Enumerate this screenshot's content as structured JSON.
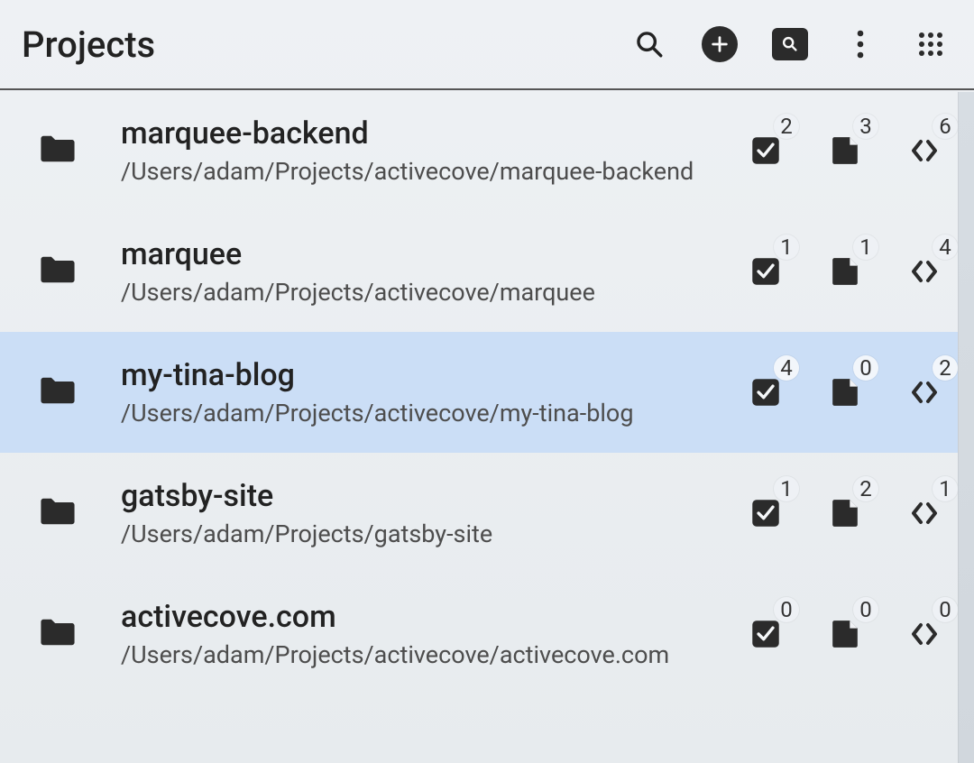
{
  "header": {
    "title": "Projects",
    "icons": {
      "search": "search-icon",
      "add": "add-icon",
      "findInProject": "find-in-project-icon",
      "more": "more-vert-icon",
      "apps": "apps-grid-icon"
    }
  },
  "projects": [
    {
      "name": "marquee-backend",
      "path": "/Users/adam/Projects/activecove/marquee-backend",
      "selected": false,
      "counts": {
        "todos": 2,
        "notes": 3,
        "snippets": 6
      }
    },
    {
      "name": "marquee",
      "path": "/Users/adam/Projects/activecove/marquee",
      "selected": false,
      "counts": {
        "todos": 1,
        "notes": 1,
        "snippets": 4
      }
    },
    {
      "name": "my-tina-blog",
      "path": "/Users/adam/Projects/activecove/my-tina-blog",
      "selected": true,
      "counts": {
        "todos": 4,
        "notes": 0,
        "snippets": 2
      }
    },
    {
      "name": "gatsby-site",
      "path": "/Users/adam/Projects/gatsby-site",
      "selected": false,
      "counts": {
        "todos": 1,
        "notes": 2,
        "snippets": 1
      }
    },
    {
      "name": "activecove.com",
      "path": "/Users/adam/Projects/activecove/activecove.com",
      "selected": false,
      "counts": {
        "todos": 0,
        "notes": 0,
        "snippets": 0
      }
    }
  ]
}
